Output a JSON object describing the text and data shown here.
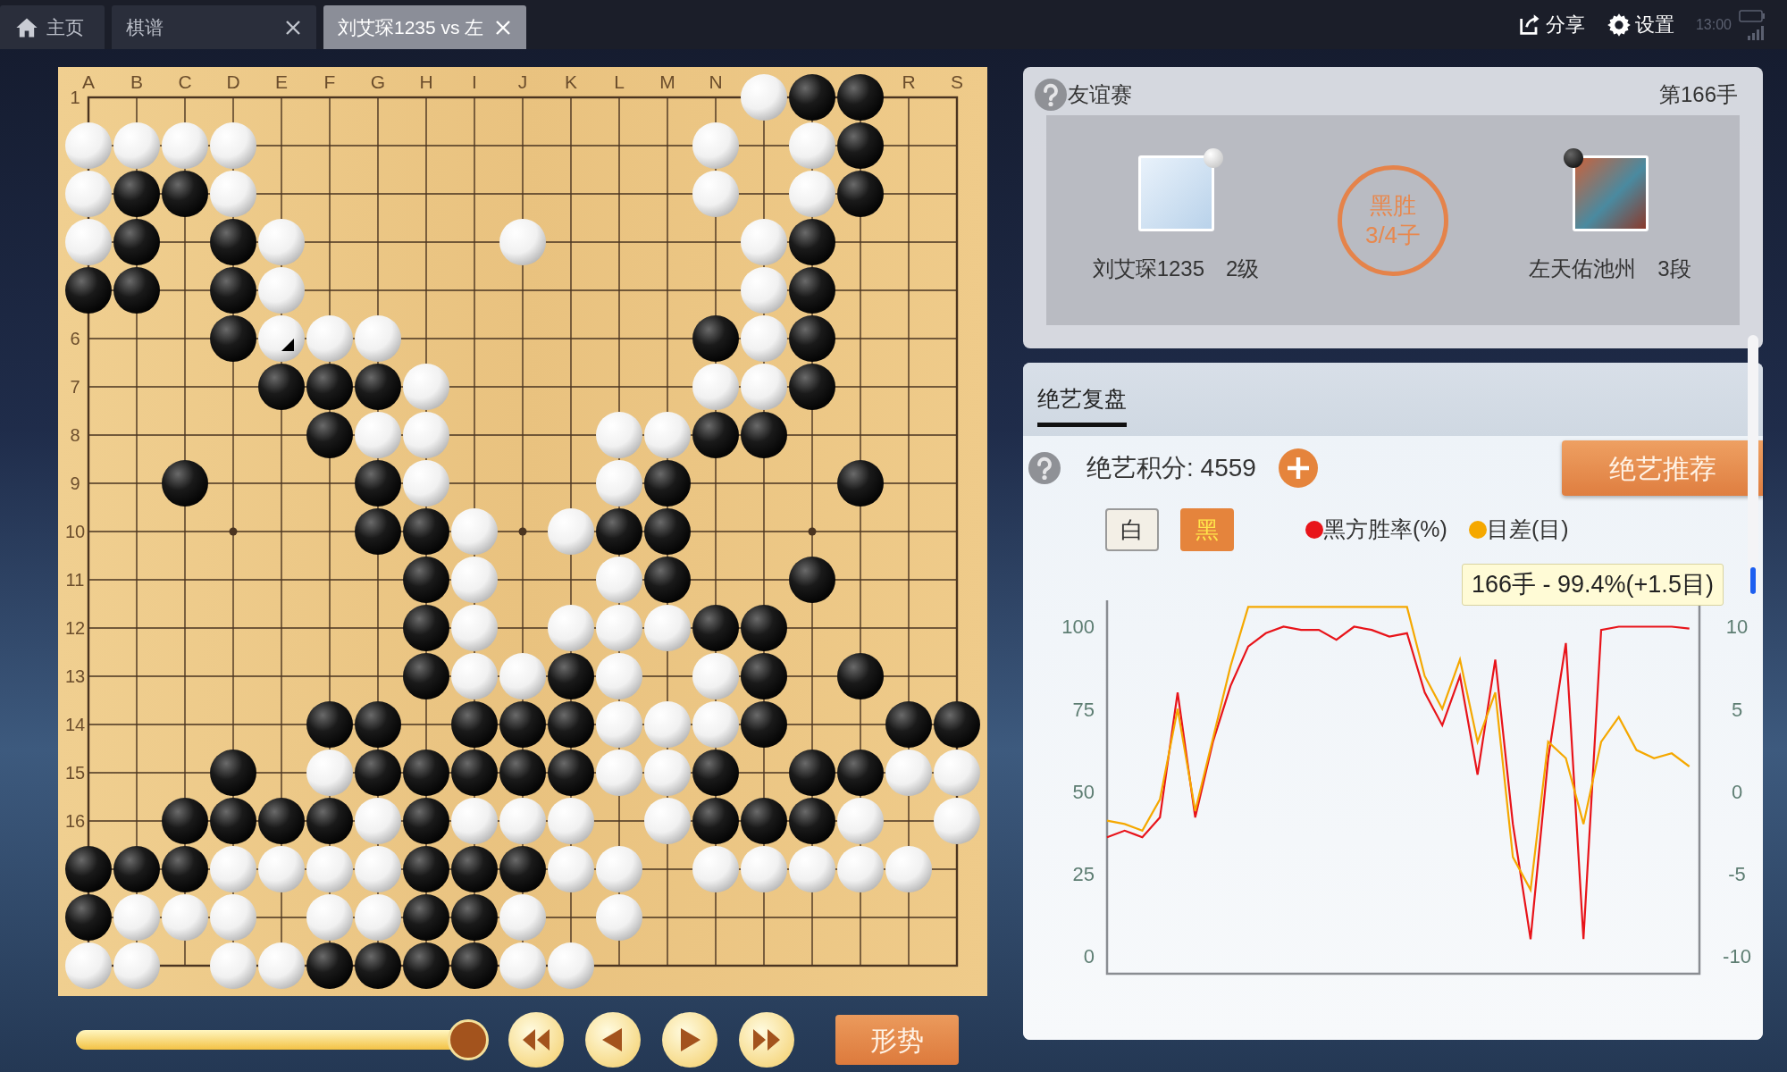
{
  "tabs": [
    {
      "label": "主页",
      "kind": "home",
      "selected": false,
      "closable": false
    },
    {
      "label": "棋谱",
      "kind": "plain",
      "selected": false,
      "closable": true
    },
    {
      "label": "刘艾琛1235 vs 左",
      "kind": "plain",
      "selected": true,
      "closable": true
    }
  ],
  "actions": [
    {
      "label": "分享",
      "kind": "share"
    },
    {
      "label": "设置",
      "kind": "settings"
    }
  ],
  "status": {
    "time": "13:00"
  },
  "board": {
    "columns": [
      {
        "label": "A"
      },
      {
        "label": "B"
      },
      {
        "label": "C"
      },
      {
        "label": "D"
      },
      {
        "label": "E"
      },
      {
        "label": "F"
      },
      {
        "label": "G"
      },
      {
        "label": "H"
      },
      {
        "label": "I"
      },
      {
        "label": "J"
      },
      {
        "label": "K"
      },
      {
        "label": "L"
      },
      {
        "label": "M"
      },
      {
        "label": "N"
      },
      {},
      {},
      {},
      {
        "label": "R"
      },
      {
        "label": "S"
      }
    ],
    "rows": [
      {
        "label": "1",
        "points": [
          {
            "kind": "empty"
          },
          {
            "kind": "empty"
          },
          {
            "kind": "empty"
          },
          {
            "kind": "empty"
          },
          {
            "kind": "empty"
          },
          {
            "kind": "empty"
          },
          {
            "kind": "empty"
          },
          {
            "kind": "empty"
          },
          {
            "kind": "empty"
          },
          {
            "kind": "empty"
          },
          {
            "kind": "empty"
          },
          {
            "kind": "empty"
          },
          {
            "kind": "empty"
          },
          {
            "kind": "empty"
          },
          {
            "kind": "white"
          },
          {
            "kind": "black"
          },
          {
            "kind": "black"
          },
          {
            "kind": "empty"
          },
          {
            "kind": "empty"
          }
        ]
      },
      {
        "points": [
          {
            "kind": "white"
          },
          {
            "kind": "white"
          },
          {
            "kind": "white"
          },
          {
            "kind": "white"
          },
          {
            "kind": "empty"
          },
          {
            "kind": "empty"
          },
          {
            "kind": "empty"
          },
          {
            "kind": "empty"
          },
          {
            "kind": "empty"
          },
          {
            "kind": "empty"
          },
          {
            "kind": "empty"
          },
          {
            "kind": "empty"
          },
          {
            "kind": "empty"
          },
          {
            "kind": "white"
          },
          {
            "kind": "empty"
          },
          {
            "kind": "white"
          },
          {
            "kind": "black"
          },
          {
            "kind": "empty"
          },
          {
            "kind": "empty"
          }
        ]
      },
      {
        "points": [
          {
            "kind": "white"
          },
          {
            "kind": "black"
          },
          {
            "kind": "black"
          },
          {
            "kind": "white"
          },
          {
            "kind": "empty"
          },
          {
            "kind": "empty"
          },
          {
            "kind": "empty"
          },
          {
            "kind": "empty"
          },
          {
            "kind": "empty"
          },
          {
            "kind": "empty"
          },
          {
            "kind": "empty"
          },
          {
            "kind": "empty"
          },
          {
            "kind": "empty"
          },
          {
            "kind": "white"
          },
          {
            "kind": "empty"
          },
          {
            "kind": "white"
          },
          {
            "kind": "black"
          },
          {
            "kind": "empty"
          },
          {
            "kind": "empty"
          }
        ]
      },
      {
        "points": [
          {
            "kind": "white"
          },
          {
            "kind": "black"
          },
          {
            "kind": "empty"
          },
          {
            "kind": "black"
          },
          {
            "kind": "white"
          },
          {
            "kind": "empty"
          },
          {
            "kind": "empty"
          },
          {
            "kind": "empty"
          },
          {
            "kind": "empty"
          },
          {
            "kind": "white"
          },
          {
            "kind": "empty"
          },
          {
            "kind": "empty"
          },
          {
            "kind": "empty"
          },
          {
            "kind": "empty"
          },
          {
            "kind": "white"
          },
          {
            "kind": "black"
          },
          {
            "kind": "empty"
          },
          {
            "kind": "empty"
          },
          {
            "kind": "empty"
          }
        ]
      },
      {
        "points": [
          {
            "kind": "black"
          },
          {
            "kind": "black"
          },
          {
            "kind": "empty"
          },
          {
            "kind": "black"
          },
          {
            "kind": "white"
          },
          {
            "kind": "empty"
          },
          {
            "kind": "empty"
          },
          {
            "kind": "empty"
          },
          {
            "kind": "empty"
          },
          {
            "kind": "empty"
          },
          {
            "kind": "empty"
          },
          {
            "kind": "empty"
          },
          {
            "kind": "empty"
          },
          {
            "kind": "empty"
          },
          {
            "kind": "white"
          },
          {
            "kind": "black"
          },
          {
            "kind": "empty"
          },
          {
            "kind": "empty"
          },
          {
            "kind": "empty"
          }
        ]
      },
      {
        "label": "6",
        "points": [
          {
            "kind": "empty"
          },
          {
            "kind": "empty"
          },
          {
            "kind": "empty"
          },
          {
            "kind": "black"
          },
          {
            "kind": "lastwhite"
          },
          {
            "kind": "white"
          },
          {
            "kind": "white"
          },
          {
            "kind": "empty"
          },
          {
            "kind": "empty"
          },
          {
            "kind": "empty"
          },
          {
            "kind": "empty"
          },
          {
            "kind": "empty"
          },
          {
            "kind": "empty"
          },
          {
            "kind": "black"
          },
          {
            "kind": "white"
          },
          {
            "kind": "black"
          },
          {
            "kind": "empty"
          },
          {
            "kind": "empty"
          },
          {
            "kind": "empty"
          }
        ]
      },
      {
        "label": "7",
        "points": [
          {
            "kind": "empty"
          },
          {
            "kind": "empty"
          },
          {
            "kind": "empty"
          },
          {
            "kind": "empty"
          },
          {
            "kind": "black"
          },
          {
            "kind": "black"
          },
          {
            "kind": "black"
          },
          {
            "kind": "white"
          },
          {
            "kind": "empty"
          },
          {
            "kind": "empty"
          },
          {
            "kind": "empty"
          },
          {
            "kind": "empty"
          },
          {
            "kind": "empty"
          },
          {
            "kind": "white"
          },
          {
            "kind": "white"
          },
          {
            "kind": "black"
          },
          {
            "kind": "empty"
          },
          {
            "kind": "empty"
          },
          {
            "kind": "empty"
          }
        ]
      },
      {
        "label": "8",
        "points": [
          {
            "kind": "empty"
          },
          {
            "kind": "empty"
          },
          {
            "kind": "empty"
          },
          {
            "kind": "empty"
          },
          {
            "kind": "empty"
          },
          {
            "kind": "black"
          },
          {
            "kind": "white"
          },
          {
            "kind": "white"
          },
          {
            "kind": "empty"
          },
          {
            "kind": "empty"
          },
          {
            "kind": "empty"
          },
          {
            "kind": "white"
          },
          {
            "kind": "white"
          },
          {
            "kind": "black"
          },
          {
            "kind": "black"
          },
          {
            "kind": "empty"
          },
          {
            "kind": "empty"
          },
          {
            "kind": "empty"
          },
          {
            "kind": "empty"
          }
        ]
      },
      {
        "label": "9",
        "points": [
          {
            "kind": "empty"
          },
          {
            "kind": "empty"
          },
          {
            "kind": "black"
          },
          {
            "kind": "empty"
          },
          {
            "kind": "empty"
          },
          {
            "kind": "empty"
          },
          {
            "kind": "black"
          },
          {
            "kind": "white"
          },
          {
            "kind": "empty"
          },
          {
            "kind": "empty"
          },
          {
            "kind": "empty"
          },
          {
            "kind": "white"
          },
          {
            "kind": "black"
          },
          {
            "kind": "empty"
          },
          {
            "kind": "empty"
          },
          {
            "kind": "empty"
          },
          {
            "kind": "black"
          },
          {
            "kind": "empty"
          },
          {
            "kind": "empty"
          }
        ]
      },
      {
        "label": "10",
        "points": [
          {
            "kind": "empty"
          },
          {
            "kind": "empty"
          },
          {
            "kind": "empty"
          },
          {
            "kind": "empty"
          },
          {
            "kind": "empty"
          },
          {
            "kind": "empty"
          },
          {
            "kind": "black"
          },
          {
            "kind": "black"
          },
          {
            "kind": "white"
          },
          {
            "kind": "empty"
          },
          {
            "kind": "white"
          },
          {
            "kind": "black"
          },
          {
            "kind": "black"
          },
          {
            "kind": "empty"
          },
          {
            "kind": "empty"
          },
          {
            "kind": "empty"
          },
          {
            "kind": "empty"
          },
          {
            "kind": "empty"
          },
          {
            "kind": "empty"
          }
        ]
      },
      {
        "label": "11",
        "points": [
          {
            "kind": "empty"
          },
          {
            "kind": "empty"
          },
          {
            "kind": "empty"
          },
          {
            "kind": "empty"
          },
          {
            "kind": "empty"
          },
          {
            "kind": "empty"
          },
          {
            "kind": "empty"
          },
          {
            "kind": "black"
          },
          {
            "kind": "white"
          },
          {
            "kind": "empty"
          },
          {
            "kind": "empty"
          },
          {
            "kind": "white"
          },
          {
            "kind": "black"
          },
          {
            "kind": "empty"
          },
          {
            "kind": "empty"
          },
          {
            "kind": "black"
          },
          {
            "kind": "empty"
          },
          {
            "kind": "empty"
          },
          {
            "kind": "empty"
          }
        ]
      },
      {
        "label": "12",
        "points": [
          {
            "kind": "empty"
          },
          {
            "kind": "empty"
          },
          {
            "kind": "empty"
          },
          {
            "kind": "empty"
          },
          {
            "kind": "empty"
          },
          {
            "kind": "empty"
          },
          {
            "kind": "empty"
          },
          {
            "kind": "black"
          },
          {
            "kind": "white"
          },
          {
            "kind": "empty"
          },
          {
            "kind": "white"
          },
          {
            "kind": "white"
          },
          {
            "kind": "white"
          },
          {
            "kind": "black"
          },
          {
            "kind": "black"
          },
          {
            "kind": "empty"
          },
          {
            "kind": "empty"
          },
          {
            "kind": "empty"
          },
          {
            "kind": "empty"
          }
        ]
      },
      {
        "label": "13",
        "points": [
          {
            "kind": "empty"
          },
          {
            "kind": "empty"
          },
          {
            "kind": "empty"
          },
          {
            "kind": "empty"
          },
          {
            "kind": "empty"
          },
          {
            "kind": "empty"
          },
          {
            "kind": "empty"
          },
          {
            "kind": "black"
          },
          {
            "kind": "white"
          },
          {
            "kind": "white"
          },
          {
            "kind": "black"
          },
          {
            "kind": "white"
          },
          {
            "kind": "empty"
          },
          {
            "kind": "white"
          },
          {
            "kind": "black"
          },
          {
            "kind": "empty"
          },
          {
            "kind": "black"
          },
          {
            "kind": "empty"
          },
          {
            "kind": "empty"
          }
        ]
      },
      {
        "label": "14",
        "points": [
          {
            "kind": "empty"
          },
          {
            "kind": "empty"
          },
          {
            "kind": "empty"
          },
          {
            "kind": "empty"
          },
          {
            "kind": "empty"
          },
          {
            "kind": "black"
          },
          {
            "kind": "black"
          },
          {
            "kind": "empty"
          },
          {
            "kind": "black"
          },
          {
            "kind": "black"
          },
          {
            "kind": "black"
          },
          {
            "kind": "white"
          },
          {
            "kind": "white"
          },
          {
            "kind": "white"
          },
          {
            "kind": "black"
          },
          {
            "kind": "empty"
          },
          {
            "kind": "empty"
          },
          {
            "kind": "black"
          },
          {
            "kind": "black"
          }
        ]
      },
      {
        "label": "15",
        "points": [
          {
            "kind": "empty"
          },
          {
            "kind": "empty"
          },
          {
            "kind": "empty"
          },
          {
            "kind": "black"
          },
          {
            "kind": "empty"
          },
          {
            "kind": "white"
          },
          {
            "kind": "black"
          },
          {
            "kind": "black"
          },
          {
            "kind": "black"
          },
          {
            "kind": "black"
          },
          {
            "kind": "black"
          },
          {
            "kind": "white"
          },
          {
            "kind": "white"
          },
          {
            "kind": "black"
          },
          {
            "kind": "empty"
          },
          {
            "kind": "black"
          },
          {
            "kind": "black"
          },
          {
            "kind": "white"
          },
          {
            "kind": "white"
          }
        ]
      },
      {
        "label": "16",
        "points": [
          {
            "kind": "empty"
          },
          {
            "kind": "empty"
          },
          {
            "kind": "black"
          },
          {
            "kind": "black"
          },
          {
            "kind": "black"
          },
          {
            "kind": "black"
          },
          {
            "kind": "white"
          },
          {
            "kind": "black"
          },
          {
            "kind": "white"
          },
          {
            "kind": "white"
          },
          {
            "kind": "white"
          },
          {
            "kind": "empty"
          },
          {
            "kind": "white"
          },
          {
            "kind": "black"
          },
          {
            "kind": "black"
          },
          {
            "kind": "black"
          },
          {
            "kind": "white"
          },
          {
            "kind": "empty"
          },
          {
            "kind": "white"
          }
        ]
      },
      {
        "points": [
          {
            "kind": "black"
          },
          {
            "kind": "black"
          },
          {
            "kind": "black"
          },
          {
            "kind": "white"
          },
          {
            "kind": "white"
          },
          {
            "kind": "white"
          },
          {
            "kind": "white"
          },
          {
            "kind": "black"
          },
          {
            "kind": "black"
          },
          {
            "kind": "black"
          },
          {
            "kind": "white"
          },
          {
            "kind": "white"
          },
          {
            "kind": "empty"
          },
          {
            "kind": "white"
          },
          {
            "kind": "white"
          },
          {
            "kind": "white"
          },
          {
            "kind": "white"
          },
          {
            "kind": "white"
          },
          {
            "kind": "empty"
          }
        ]
      },
      {
        "points": [
          {
            "kind": "black"
          },
          {
            "kind": "white"
          },
          {
            "kind": "white"
          },
          {
            "kind": "white"
          },
          {
            "kind": "empty"
          },
          {
            "kind": "white"
          },
          {
            "kind": "white"
          },
          {
            "kind": "black"
          },
          {
            "kind": "black"
          },
          {
            "kind": "white"
          },
          {
            "kind": "empty"
          },
          {
            "kind": "white"
          },
          {
            "kind": "empty"
          },
          {
            "kind": "empty"
          },
          {
            "kind": "empty"
          },
          {
            "kind": "empty"
          },
          {
            "kind": "empty"
          },
          {
            "kind": "empty"
          },
          {
            "kind": "empty"
          }
        ]
      },
      {
        "points": [
          {
            "kind": "white"
          },
          {
            "kind": "white"
          },
          {
            "kind": "empty"
          },
          {
            "kind": "white"
          },
          {
            "kind": "white"
          },
          {
            "kind": "black"
          },
          {
            "kind": "black"
          },
          {
            "kind": "black"
          },
          {
            "kind": "black"
          },
          {
            "kind": "white"
          },
          {
            "kind": "white"
          },
          {
            "kind": "empty"
          },
          {
            "kind": "empty"
          },
          {
            "kind": "empty"
          },
          {
            "kind": "empty"
          },
          {
            "kind": "empty"
          },
          {
            "kind": "empty"
          },
          {
            "kind": "empty"
          },
          {
            "kind": "empty"
          }
        ]
      }
    ]
  },
  "controls": {
    "slider": {
      "level": 1
    },
    "nav_buttons": [
      {
        "kind": "first"
      },
      {
        "kind": "previous"
      },
      {
        "kind": "next"
      },
      {
        "kind": "last"
      }
    ],
    "situation_button": "形势"
  },
  "game": {
    "type": "友谊赛",
    "move": "第166手",
    "result": "黑胜",
    "margin": "3/4子",
    "players": [
      {
        "name": "刘艾琛1235",
        "rank": "2级",
        "kind": "white"
      },
      {
        "name": "左天佑池州",
        "rank": "3段",
        "kind": "black"
      }
    ]
  },
  "analysis": {
    "tabs": [
      {
        "label": "绝艺复盘",
        "selected": true
      }
    ],
    "score": "绝艺积分: 4559",
    "recommend_button": "绝艺推荐",
    "sides": [
      {
        "label": "白",
        "selected": false
      },
      {
        "label": "黑",
        "selected": true
      }
    ],
    "tooltip": "166手 - 99.4%(+1.5目)",
    "right_axis_labels": [
      "10",
      "5",
      "0",
      "-5",
      "-10"
    ],
    "chart_data": {
      "type": "line",
      "categories": [
        null,
        null,
        null,
        null,
        null,
        null,
        null,
        null,
        null,
        null,
        null,
        null,
        null,
        null,
        null,
        null,
        null,
        null,
        null,
        null,
        null,
        null,
        null,
        null,
        null,
        null,
        null,
        null,
        null,
        null,
        null,
        null,
        null,
        null
      ],
      "ylim": [
        -5.5,
        108
      ],
      "yticks": [
        0,
        25,
        50,
        75,
        100
      ],
      "series": [
        {
          "name": "黑方胜率(%)",
          "color": "#e8141a",
          "values": [
            36,
            38,
            36,
            42,
            80,
            42,
            65,
            82,
            94,
            98,
            100,
            99,
            99,
            96,
            100,
            99,
            97,
            98,
            80,
            70,
            85,
            55,
            90,
            40,
            5,
            60,
            95,
            5,
            99,
            100,
            100,
            100,
            100,
            99.4
          ]
        },
        {
          "name": "目差(目)",
          "color": "#f5a800",
          "values": [
            41,
            40,
            38,
            47.5,
            75,
            44,
            66,
            88,
            106,
            106,
            106,
            106,
            106,
            106,
            106,
            106,
            106,
            106,
            85,
            75,
            90,
            65,
            80,
            30,
            20,
            65,
            60,
            40,
            65,
            72.5,
            62.5,
            60,
            61.5,
            57.5
          ]
        }
      ]
    }
  }
}
